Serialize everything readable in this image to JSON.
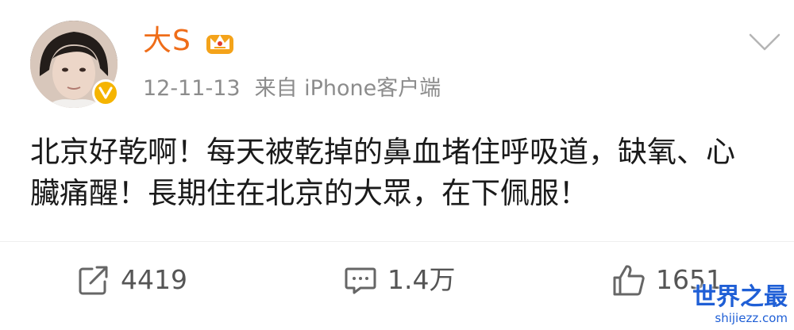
{
  "post": {
    "author": {
      "name": "大S",
      "avatar_icon": "profile-photo",
      "verified_icon": "verified-badge-icon",
      "member_icon": "crown-icon"
    },
    "timestamp": "12-11-13",
    "source": "来自 iPhone客户端",
    "body": "北京好乾啊！每天被乾掉的鼻血堵住呼吸道，缺氧、心臟痛醒！長期住在北京的大眾，在下佩服！",
    "actions": {
      "repost_count": "4419",
      "comment_count": "1.4万",
      "like_count": "1651"
    }
  },
  "watermark": {
    "title": "世界之最",
    "url": "shijiezz.com"
  },
  "colors": {
    "name": "#ef6d19",
    "meta": "#8c8c8c",
    "body": "#1a1a1a",
    "action": "#555555",
    "verified": "#f5b400",
    "watermark": "#1f5fd6"
  }
}
